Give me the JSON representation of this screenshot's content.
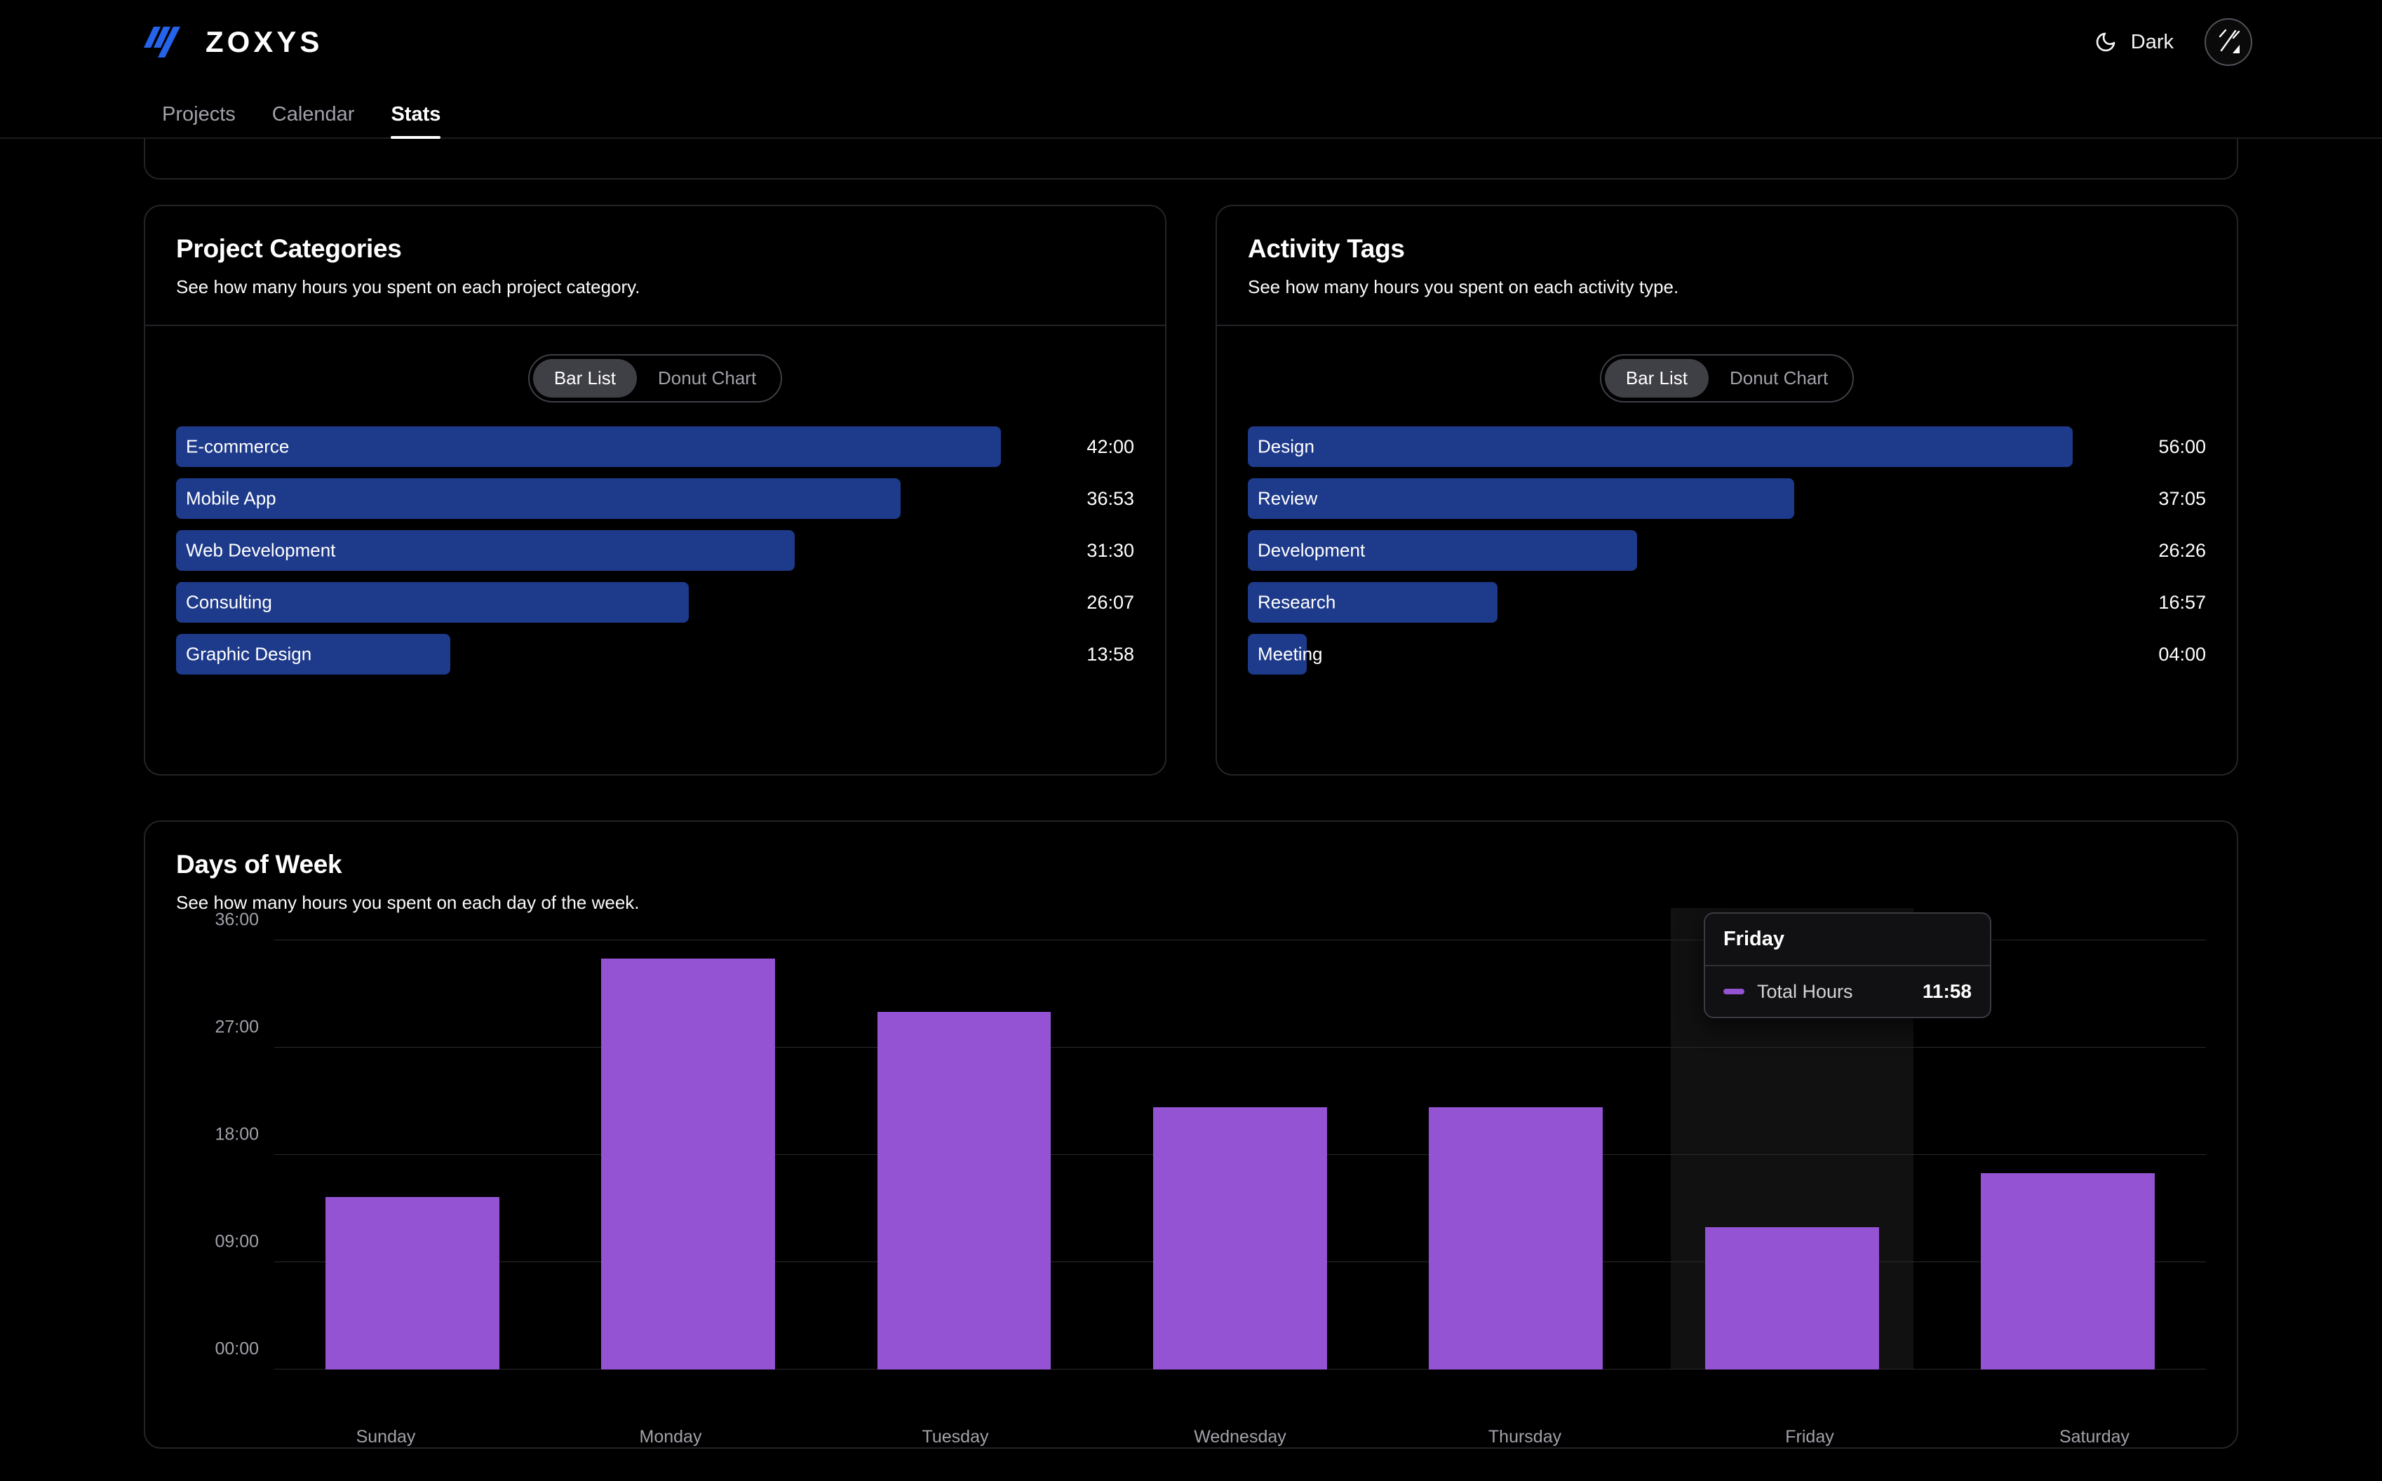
{
  "header": {
    "brand_name": "ZOXYS",
    "logo_icon": "zoxys-slashes-logo",
    "theme_label": "Dark",
    "theme_icon": "moon-icon",
    "avatar_icon": "user-avatar"
  },
  "nav": {
    "tabs": [
      {
        "label": "Projects",
        "active": false
      },
      {
        "label": "Calendar",
        "active": false
      },
      {
        "label": "Stats",
        "active": true
      }
    ]
  },
  "project_categories": {
    "title": "Project Categories",
    "subtitle": "See how many hours you spent on each project category.",
    "toggle": {
      "options": [
        "Bar List",
        "Donut Chart"
      ],
      "selected": "Bar List"
    }
  },
  "activity_tags": {
    "title": "Activity Tags",
    "subtitle": "See how many hours you spent on each activity type.",
    "toggle": {
      "options": [
        "Bar List",
        "Donut Chart"
      ],
      "selected": "Bar List"
    }
  },
  "days_of_week": {
    "title": "Days of Week",
    "subtitle": "See how many hours you spent on each day of the week.",
    "tooltip": {
      "title": "Friday",
      "series_name": "Total Hours",
      "value": "11:58"
    }
  },
  "colors": {
    "bar_blue": "#1e3a8a",
    "bar_purple": "#9353d3",
    "accent_logo": "#2563eb",
    "card_border": "#242428",
    "toggle_active_bg": "#3f3f46"
  },
  "chart_data": [
    {
      "type": "bar",
      "orientation": "horizontal",
      "title": "Project Categories",
      "xlabel": "",
      "ylabel": "",
      "categories": [
        "E-commerce",
        "Mobile App",
        "Web Development",
        "Consulting",
        "Graphic Design"
      ],
      "values": [
        42.0,
        36.883,
        31.5,
        26.117,
        13.967
      ],
      "value_labels": [
        "42:00",
        "36:53",
        "31:30",
        "26:07",
        "13:58"
      ],
      "max": 42.0,
      "grid": false,
      "legend": "none"
    },
    {
      "type": "bar",
      "orientation": "horizontal",
      "title": "Activity Tags",
      "xlabel": "",
      "ylabel": "",
      "categories": [
        "Design",
        "Review",
        "Development",
        "Research",
        "Meeting"
      ],
      "values": [
        56.0,
        37.083,
        26.433,
        16.95,
        4.0
      ],
      "value_labels": [
        "56:00",
        "37:05",
        "26:26",
        "16:57",
        "04:00"
      ],
      "max": 56.0,
      "grid": false,
      "legend": "none"
    },
    {
      "type": "bar",
      "orientation": "vertical",
      "title": "Days of Week",
      "xlabel": "",
      "ylabel": "",
      "series": [
        {
          "name": "Total Hours",
          "values": [
            14.5,
            34.5,
            30.0,
            22.0,
            22.0,
            11.967,
            16.5
          ]
        }
      ],
      "categories": [
        "Sunday",
        "Monday",
        "Tuesday",
        "Wednesday",
        "Thursday",
        "Friday",
        "Saturday"
      ],
      "ytick_labels": [
        "00:00",
        "09:00",
        "18:00",
        "27:00",
        "36:00"
      ],
      "ytick_values": [
        0,
        9,
        18,
        27,
        36
      ],
      "ylim": [
        0,
        36
      ],
      "grid": true,
      "legend": "none",
      "hovered_category": "Friday"
    }
  ]
}
